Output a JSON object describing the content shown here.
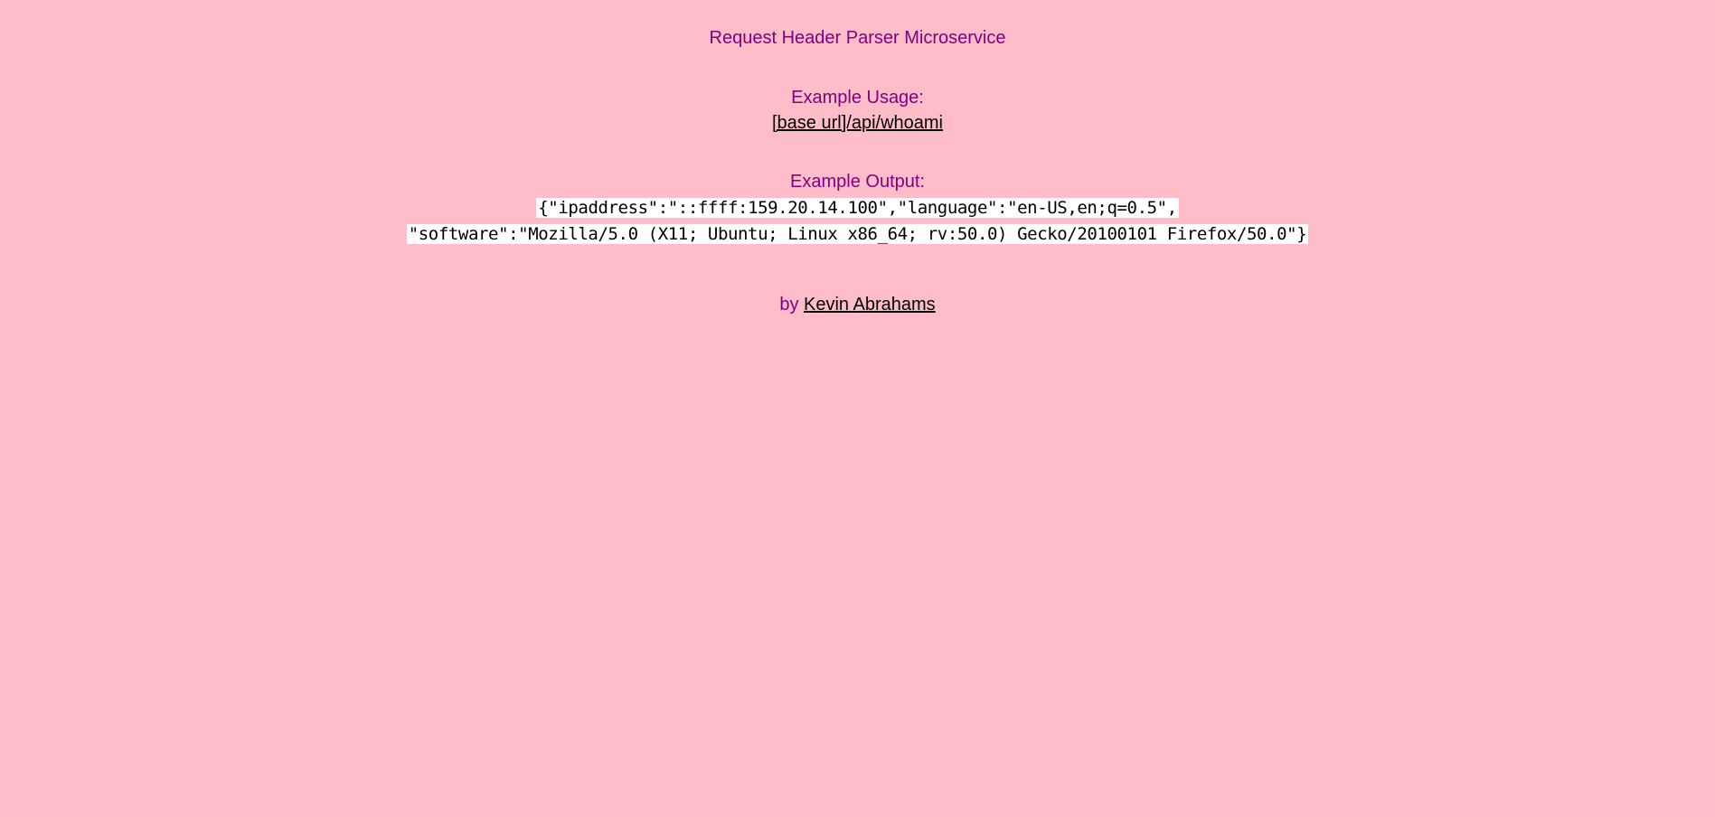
{
  "header": {
    "title": "Request Header Parser Microservice"
  },
  "usage": {
    "heading": "Example Usage:",
    "link_text": "[base url]/api/whoami"
  },
  "output": {
    "heading": "Example Output:",
    "line1": "{\"ipaddress\":\"::ffff:159.20.14.100\",\"language\":\"en-US,en;q=0.5\",",
    "line2": "\"software\":\"Mozilla/5.0 (X11; Ubuntu; Linux x86_64; rv:50.0) Gecko/20100101 Firefox/50.0\"}"
  },
  "footer": {
    "by_label": "by",
    "author": "Kevin Abrahams"
  },
  "colors": {
    "background": "#FFBDC9",
    "heading_text": "#800080",
    "link_text": "#000000",
    "code_background": "#FFFFFF"
  }
}
